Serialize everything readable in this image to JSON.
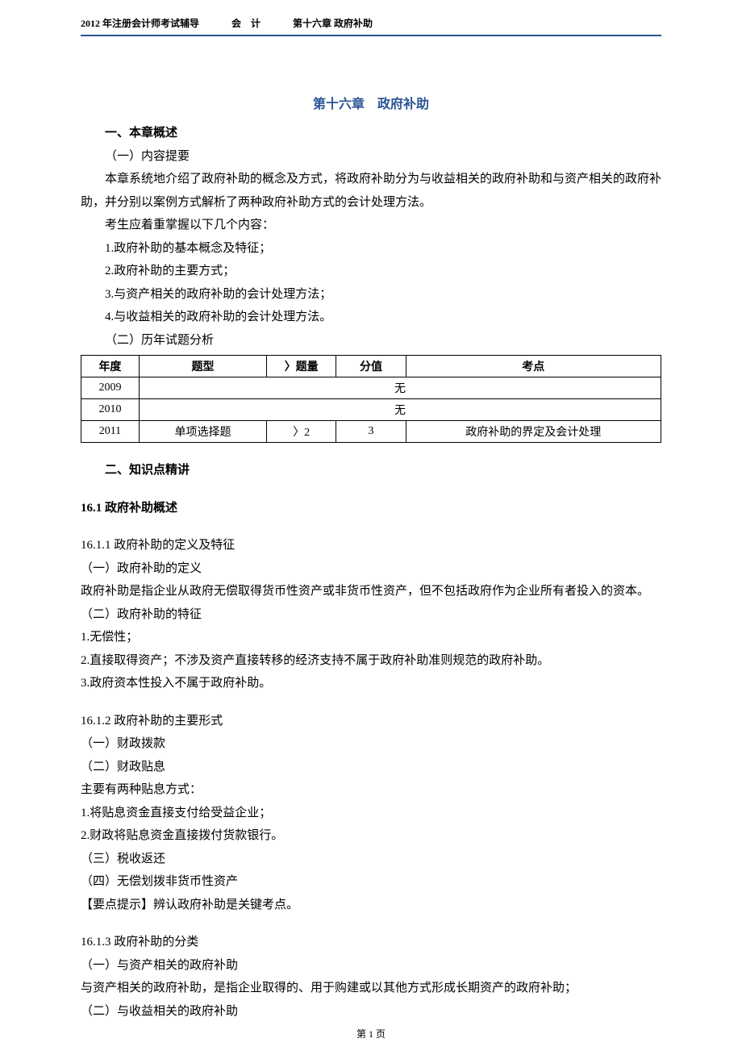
{
  "header": {
    "left": "2012 年注册会计师考试辅导",
    "mid": "会　计",
    "right": "第十六章 政府补助"
  },
  "chapter_title": "第十六章　政府补助",
  "sec1": {
    "heading": "一、本章概述",
    "sub1": "（一）内容提要",
    "p1": "本章系统地介绍了政府补助的概念及方式，将政府补助分为与收益相关的政府补助和与资产相关的政府补助，并分别以案例方式解析了两种政府补助方式的会计处理方法。",
    "p2": "考生应着重掌握以下几个内容：",
    "li1": "1.政府补助的基本概念及特征；",
    "li2": "2.政府补助的主要方式；",
    "li3": "3.与资产相关的政府补助的会计处理方法；",
    "li4": "4.与收益相关的政府补助的会计处理方法。",
    "sub2": "（二）历年试题分析"
  },
  "table": {
    "h_year": "年度",
    "h_type": "题型",
    "h_qty": "〉题量",
    "h_score": "分值",
    "h_point": "考点",
    "r1_year": "2009",
    "r1_none": "无",
    "r2_year": "2010",
    "r2_none": "无",
    "r3_year": "2011",
    "r3_type": "单项选择题",
    "r3_qty": "〉2",
    "r3_score": "3",
    "r3_point": "政府补助的界定及会计处理"
  },
  "sec2_heading": "二、知识点精讲",
  "sec16_1_heading": "16.1 政府补助概述",
  "s16_1_1": {
    "title": "16.1.1 政府补助的定义及特征",
    "a": "（一）政府补助的定义",
    "atext": "政府补助是指企业从政府无偿取得货币性资产或非货币性资产，但不包括政府作为企业所有者投入的资本。",
    "b": "（二）政府补助的特征",
    "b1": "1.无偿性；",
    "b2": "2.直接取得资产；不涉及资产直接转移的经济支持不属于政府补助准则规范的政府补助。",
    "b3": "3.政府资本性投入不属于政府补助。"
  },
  "s16_1_2": {
    "title": "16.1.2 政府补助的主要形式",
    "a": "（一）财政拨款",
    "b": "（二）财政贴息",
    "btext": "主要有两种贴息方式：",
    "b1": "1.将贴息资金直接支付给受益企业；",
    "b2": "2.财政将贴息资金直接拨付货款银行。",
    "c": "（三）税收返还",
    "d": "（四）无偿划拨非货币性资产",
    "tip": "【要点提示】辨认政府补助是关键考点。"
  },
  "s16_1_3": {
    "title": "16.1.3 政府补助的分类",
    "a": "（一）与资产相关的政府补助",
    "atext": "与资产相关的政府补助，是指企业取得的、用于购建或以其他方式形成长期资产的政府补助；",
    "b": "（二）与收益相关的政府补助"
  },
  "footer_page": "第 1 页"
}
